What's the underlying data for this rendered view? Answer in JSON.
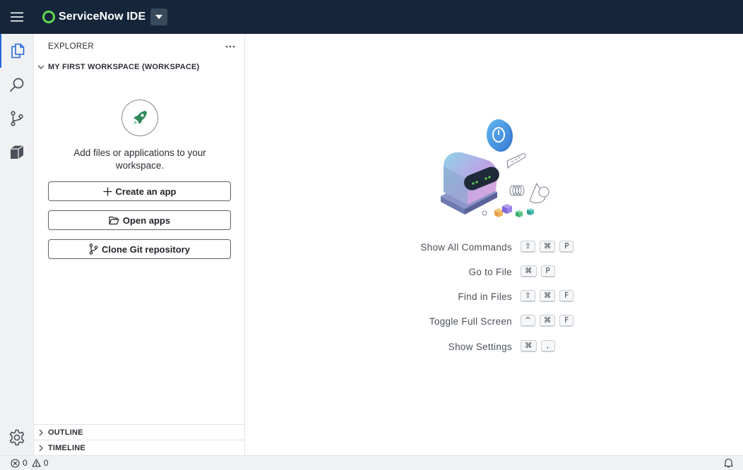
{
  "app": {
    "title": "ServiceNow IDE"
  },
  "sidebar": {
    "header": "EXPLORER",
    "workspace_title": "MY FIRST WORKSPACE (WORKSPACE)",
    "empty_message": "Add files or applications to your workspace.",
    "buttons": [
      {
        "label": "Create an app",
        "icon": "plus-icon"
      },
      {
        "label": "Open apps",
        "icon": "folder-open-icon"
      },
      {
        "label": "Clone Git repository",
        "icon": "git-branch-icon"
      }
    ],
    "sections": [
      {
        "label": "OUTLINE"
      },
      {
        "label": "TIMELINE"
      }
    ]
  },
  "activitybar": {
    "items": [
      {
        "name": "explorer",
        "icon": "files-icon",
        "active": true
      },
      {
        "name": "search",
        "icon": "search-icon",
        "active": false
      },
      {
        "name": "source-control",
        "icon": "source-control-icon",
        "active": false
      },
      {
        "name": "packages",
        "icon": "cube-icon",
        "active": false
      }
    ],
    "bottom": {
      "name": "settings",
      "icon": "gear-icon"
    }
  },
  "editor": {
    "shortcuts": [
      {
        "label": "Show All Commands",
        "keys": [
          "⇧",
          "⌘",
          "P"
        ]
      },
      {
        "label": "Go to File",
        "keys": [
          "⌘",
          "P"
        ]
      },
      {
        "label": "Find in Files",
        "keys": [
          "⇧",
          "⌘",
          "F"
        ]
      },
      {
        "label": "Toggle Full Screen",
        "keys": [
          "^",
          "⌘",
          "F"
        ]
      },
      {
        "label": "Show Settings",
        "keys": [
          "⌘",
          ","
        ]
      }
    ]
  },
  "statusbar": {
    "errors": "0",
    "warnings": "0"
  },
  "colors": {
    "topbar": "#15263a",
    "accent": "#2466d8",
    "brand_green": "#62d84e"
  }
}
